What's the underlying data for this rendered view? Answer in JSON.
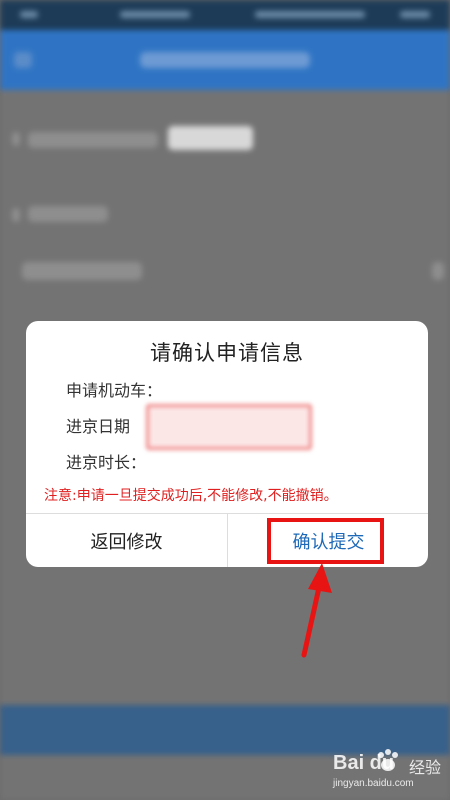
{
  "dialog": {
    "title": "请确认申请信息",
    "fields": [
      {
        "label": "申请机动车：",
        "value": ""
      },
      {
        "label": "进京日期",
        "value": ""
      },
      {
        "label": "进京时长：",
        "value": ""
      }
    ],
    "notice": "注意:申请一旦提交成功后,不能修改,不能撤销。",
    "buttons": {
      "back": "返回修改",
      "confirm": "确认提交"
    }
  },
  "watermark": {
    "logo": "Bai  du",
    "text": "经验",
    "url": "jingyan.baidu.com"
  },
  "colors": {
    "annotation_red": "#e81414",
    "confirm_blue": "#1d69b8",
    "notice_red": "#e02020",
    "header_blue": "#2f74c4"
  }
}
